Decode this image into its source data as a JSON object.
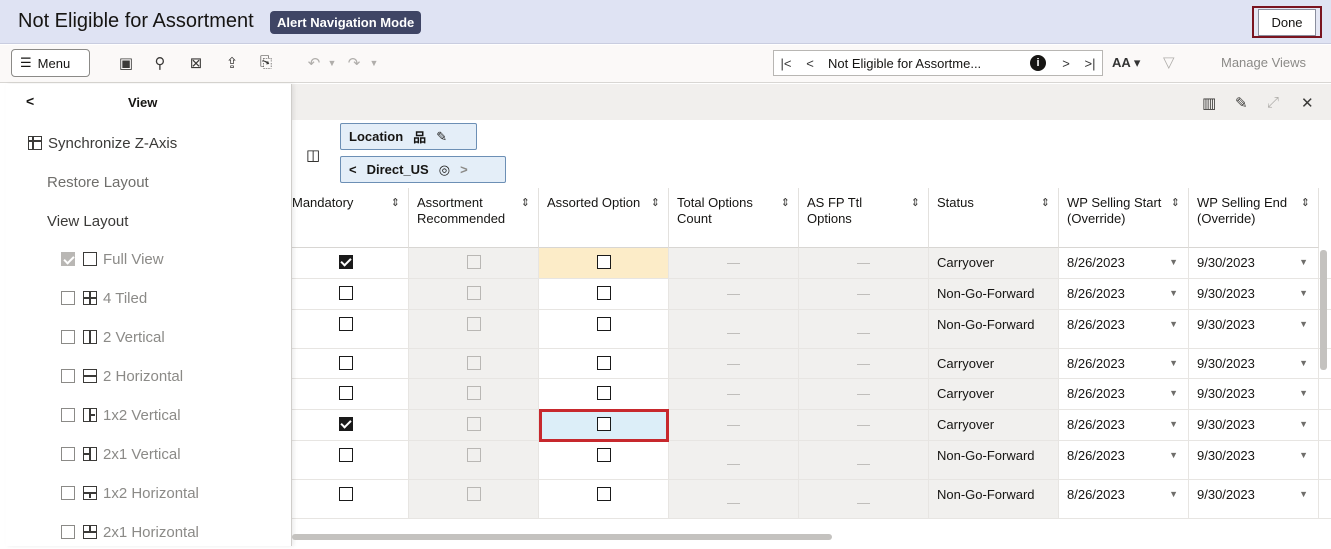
{
  "header": {
    "title": "Not Eligible for Assortment",
    "mode_badge": "Alert Navigation Mode",
    "done_label": "Done"
  },
  "toolbar": {
    "menu_label": "Menu",
    "nav_title": "Not Eligible for Assortme...",
    "font_size_label": "AA",
    "manage_views_label": "Manage Views"
  },
  "view_panel": {
    "title": "View",
    "synchronize_label": "Synchronize Z-Axis",
    "restore_label": "Restore Layout",
    "view_layout_label": "View Layout",
    "layouts": [
      {
        "label": "Full View",
        "checked": true
      },
      {
        "label": "4 Tiled",
        "checked": false
      },
      {
        "label": "2 Vertical",
        "checked": false
      },
      {
        "label": "2 Horizontal",
        "checked": false
      },
      {
        "label": "1x2 Vertical",
        "checked": false
      },
      {
        "label": "2x1 Vertical",
        "checked": false
      },
      {
        "label": "1x2 Horizontal",
        "checked": false
      },
      {
        "label": "2x1 Horizontal",
        "checked": false
      }
    ]
  },
  "dimensions": {
    "location_label": "Location",
    "member_label": "Direct_US"
  },
  "grid": {
    "columns": [
      "Mandatory",
      "Assortment Recommended",
      "Assorted Option",
      "Total Options Count",
      "AS FP Ttl Options",
      "Status",
      "WP Selling Start (Override)",
      "WP Selling End (Override)"
    ],
    "placeholder_dash": "—",
    "rows": [
      {
        "mandatory": true,
        "status": "Carryover",
        "start": "8/26/2023",
        "end": "9/30/2023"
      },
      {
        "mandatory": false,
        "status": "Non-Go-Forward",
        "start": "8/26/2023",
        "end": "9/30/2023"
      },
      {
        "mandatory": false,
        "status": "Non-Go-Forward",
        "start": "8/26/2023",
        "end": "9/30/2023"
      },
      {
        "mandatory": false,
        "status": "Carryover",
        "start": "8/26/2023",
        "end": "9/30/2023"
      },
      {
        "mandatory": false,
        "status": "Carryover",
        "start": "8/26/2023",
        "end": "9/30/2023"
      },
      {
        "mandatory": true,
        "status": "Carryover",
        "start": "8/26/2023",
        "end": "9/30/2023"
      },
      {
        "mandatory": false,
        "status": "Non-Go-Forward",
        "start": "8/26/2023",
        "end": "9/30/2023"
      },
      {
        "mandatory": false,
        "status": "Non-Go-Forward",
        "start": "8/26/2023",
        "end": "9/30/2023"
      }
    ]
  },
  "colors": {
    "header_bg": "#dfe3f3",
    "badge_bg": "#3f4565",
    "done_border": "#7a1420",
    "focus_border": "#c7282d",
    "highlight_cell": "#fcecc8",
    "selected_cell": "#dceef8"
  }
}
